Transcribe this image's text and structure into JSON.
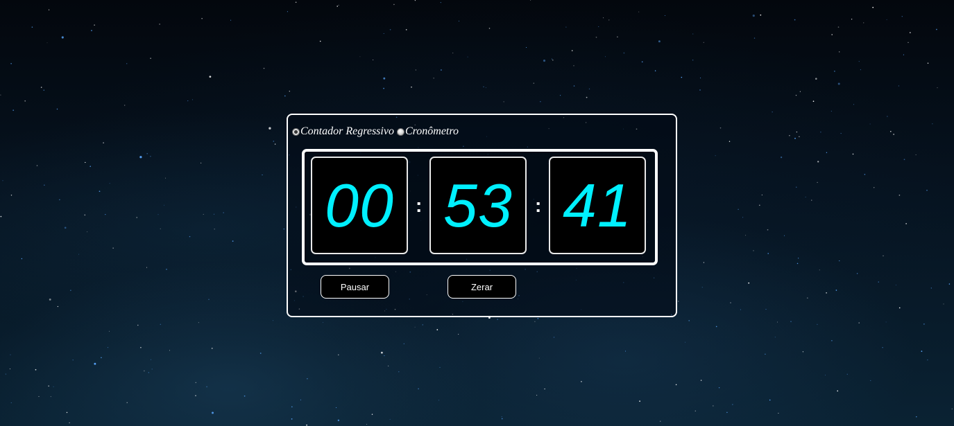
{
  "modes": {
    "countdown_label": "Contador Regressivo",
    "stopwatch_label": "Cronômetro",
    "selected": "countdown"
  },
  "clock": {
    "hours": "00",
    "minutes": "53",
    "seconds": "41",
    "separator": ":",
    "digit_color": "#00f0ff"
  },
  "buttons": {
    "pause_label": "Pausar",
    "reset_label": "Zerar"
  }
}
